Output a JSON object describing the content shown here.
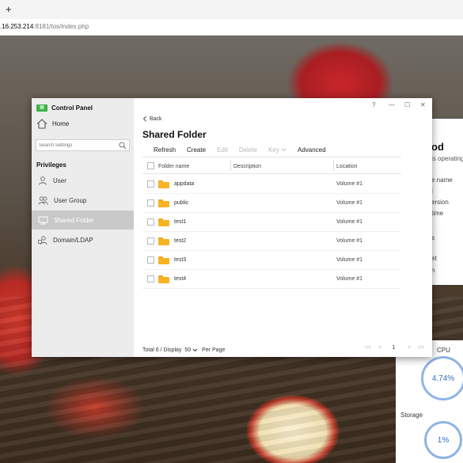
{
  "browser": {
    "new_tab": "+",
    "address_host": ".16.253.214",
    "address_path": ":8181/tos/index.php"
  },
  "background_widget": {
    "title": "od",
    "subtitle": "is operating",
    "lines": [
      "e name",
      "l",
      "ersion",
      "time",
      "s",
      "et",
      "n"
    ],
    "cpu_label": "CPU",
    "cpu_value": "4.74%",
    "storage_label": "Storage",
    "storage_value": "1%"
  },
  "window": {
    "app_title": "Control Panel",
    "controls": [
      "?",
      "—",
      "☐",
      "✕"
    ],
    "sidebar": {
      "home_label": "Home",
      "search_placeholder": "Search Settings",
      "section_title": "Privileges",
      "items": [
        {
          "label": "User",
          "icon": "user-icon",
          "active": false
        },
        {
          "label": "User Group",
          "icon": "user-group-icon",
          "active": false
        },
        {
          "label": "Shared Folder",
          "icon": "shared-folder-icon",
          "active": true
        },
        {
          "label": "Domain/LDAP",
          "icon": "domain-ldap-icon",
          "active": false
        }
      ]
    },
    "main": {
      "back_label": "Back",
      "page_title": "Shared Folder",
      "toolbar": {
        "refresh": "Refresh",
        "create": "Create",
        "edit": "Edit",
        "delete": "Delete",
        "key": "Key",
        "advanced": "Advanced"
      },
      "columns": {
        "name": "Folder name",
        "description": "Description",
        "location": "Location"
      },
      "rows": [
        {
          "name": "appdata",
          "description": "",
          "location": "Volume #1"
        },
        {
          "name": "public",
          "description": "",
          "location": "Volume #1"
        },
        {
          "name": "test1",
          "description": "",
          "location": "Volume #1"
        },
        {
          "name": "test2",
          "description": "",
          "location": "Volume #1"
        },
        {
          "name": "test3",
          "description": "",
          "location": "Volume #1"
        },
        {
          "name": "test4",
          "description": "",
          "location": "Volume #1"
        }
      ],
      "footer": {
        "total_text": "Total 6 / Display",
        "page_size": "50",
        "per_page": "Per Page",
        "pager_first": "<<",
        "pager_prev": "<",
        "page_number": "1",
        "pager_next": ">",
        "pager_last": ">>"
      }
    }
  },
  "colors": {
    "accent_green": "#3db34a",
    "folder_yellow": "#f8b324",
    "sidebar_bg": "#ececec",
    "active_item_bg": "#c9c9c9"
  }
}
